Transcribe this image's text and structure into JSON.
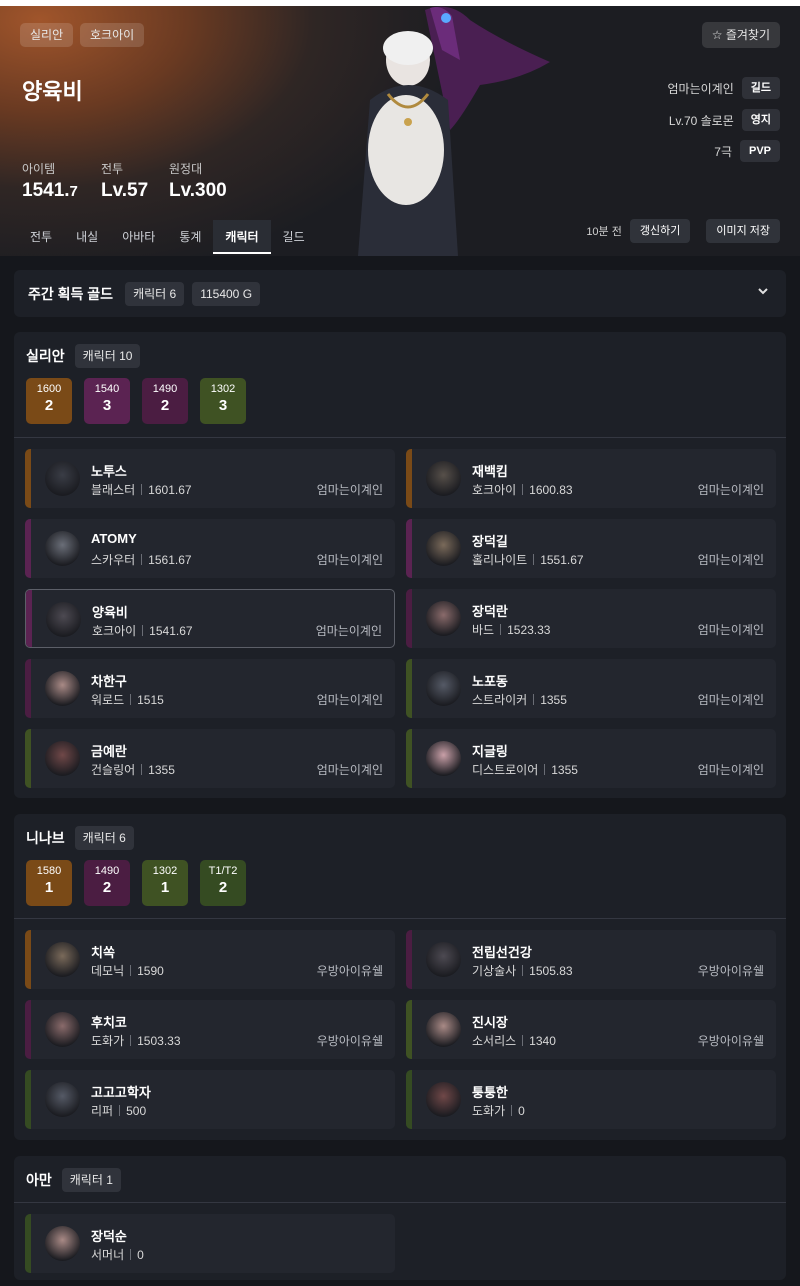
{
  "header": {
    "server": "실리안",
    "class": "호크아이",
    "name": "양육비",
    "stats": [
      {
        "label": "아이템",
        "value": "1541.",
        "suffix": "7"
      },
      {
        "label": "전투",
        "value": "Lv.57"
      },
      {
        "label": "원정대",
        "value": "Lv.300"
      }
    ],
    "favorite": "☆ 즐겨찾기",
    "info": [
      {
        "text": "엄마는이계인",
        "badge": "길드"
      },
      {
        "text": "Lv.70 솔로몬",
        "badge": "영지"
      },
      {
        "text": "7극",
        "badge": "PVP"
      }
    ],
    "tabs": [
      "전투",
      "내실",
      "아바타",
      "통계",
      "캐릭터",
      "길드"
    ],
    "active_tab": "캐릭터",
    "updated": "10분 전",
    "refresh": "갱신하기",
    "save_image": "이미지 저장"
  },
  "gold": {
    "title": "주간 획득 골드",
    "characters": "캐릭터 6",
    "amount": "115400 G"
  },
  "colors": {
    "orange": "#8a4b18",
    "purple": "#5a2450",
    "plum": "#4a1d3f",
    "green": "#3e5222",
    "darkgreen": "#344a21"
  },
  "servers": [
    {
      "name": "실리안",
      "count": "캐릭터 10",
      "levels": [
        {
          "k": "1600",
          "v": "2",
          "color": "#7a4a17"
        },
        {
          "k": "1540",
          "v": "3",
          "color": "#5b2352"
        },
        {
          "k": "1490",
          "v": "2",
          "color": "#4b1d42"
        },
        {
          "k": "1302",
          "v": "3",
          "color": "#3f5223"
        }
      ],
      "characters": [
        {
          "name": "노투스",
          "cls": "블래스터",
          "lvl": "1601.67",
          "guild": "엄마는이계인",
          "color": "#7a4a17"
        },
        {
          "name": "재백킴",
          "cls": "호크아이",
          "lvl": "1600.83",
          "guild": "엄마는이계인",
          "color": "#7a4a17"
        },
        {
          "name": "ATOMY",
          "cls": "스카우터",
          "lvl": "1561.67",
          "guild": "엄마는이계인",
          "color": "#5b2352"
        },
        {
          "name": "장덕길",
          "cls": "홀리나이트",
          "lvl": "1551.67",
          "guild": "엄마는이계인",
          "color": "#5b2352"
        },
        {
          "name": "양육비",
          "cls": "호크아이",
          "lvl": "1541.67",
          "guild": "엄마는이계인",
          "color": "#5b2352",
          "selected": true
        },
        {
          "name": "장덕란",
          "cls": "바드",
          "lvl": "1523.33",
          "guild": "엄마는이계인",
          "color": "#4b1d42"
        },
        {
          "name": "차한구",
          "cls": "워로드",
          "lvl": "1515",
          "guild": "엄마는이계인",
          "color": "#4b1d42"
        },
        {
          "name": "노포동",
          "cls": "스트라이커",
          "lvl": "1355",
          "guild": "엄마는이계인",
          "color": "#3f5223"
        },
        {
          "name": "금예란",
          "cls": "건슬링어",
          "lvl": "1355",
          "guild": "엄마는이계인",
          "color": "#3f5223"
        },
        {
          "name": "지글링",
          "cls": "디스트로이어",
          "lvl": "1355",
          "guild": "엄마는이계인",
          "color": "#3f5223"
        }
      ]
    },
    {
      "name": "니나브",
      "count": "캐릭터 6",
      "levels": [
        {
          "k": "1580",
          "v": "1",
          "color": "#7a4a17"
        },
        {
          "k": "1490",
          "v": "2",
          "color": "#4b1d42"
        },
        {
          "k": "1302",
          "v": "1",
          "color": "#3f5223"
        },
        {
          "k": "T1/T2",
          "v": "2",
          "color": "#354b22"
        }
      ],
      "characters": [
        {
          "name": "치쏙",
          "cls": "데모닉",
          "lvl": "1590",
          "guild": "우방아이유쉘",
          "color": "#7a4a17"
        },
        {
          "name": "전립선건강",
          "cls": "기상술사",
          "lvl": "1505.83",
          "guild": "우방아이유쉘",
          "color": "#4b1d42"
        },
        {
          "name": "후치코",
          "cls": "도화가",
          "lvl": "1503.33",
          "guild": "우방아이유쉘",
          "color": "#4b1d42"
        },
        {
          "name": "진시장",
          "cls": "소서리스",
          "lvl": "1340",
          "guild": "우방아이유쉘",
          "color": "#3f5223"
        },
        {
          "name": "고고고학자",
          "cls": "리퍼",
          "lvl": "500",
          "guild": "",
          "color": "#354b22"
        },
        {
          "name": "퉁퉁한",
          "cls": "도화가",
          "lvl": "0",
          "guild": "",
          "color": "#354b22"
        }
      ]
    },
    {
      "name": "아만",
      "count": "캐릭터 1",
      "levels": [],
      "characters": [
        {
          "name": "장덕순",
          "cls": "서머너",
          "lvl": "0",
          "guild": "",
          "color": "#354b22"
        }
      ]
    }
  ]
}
